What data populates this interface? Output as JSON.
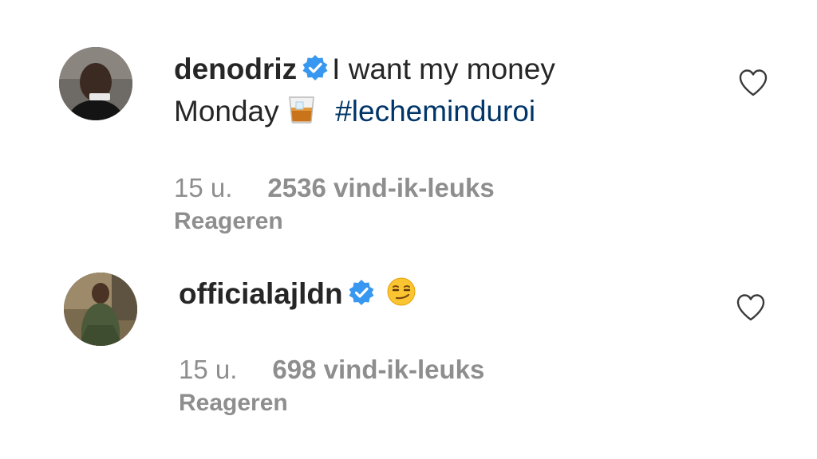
{
  "comments": [
    {
      "username": "denodriz",
      "text_line1": "I want my money",
      "text_line2": "Monday",
      "hashtag": "#lecheminduroi",
      "time": "15 u.",
      "likes": "2536 vind-ik-leuks",
      "reply_label": "Reageren",
      "emoji": "whisky-glass-emoji",
      "verified_icon": "verified-badge-icon",
      "heart_icon": "heart-outline-icon"
    },
    {
      "username": "officialajldn",
      "time": "15 u.",
      "likes": "698 vind-ik-leuks",
      "reply_label": "Reageren",
      "emoji": "smirking-face-emoji",
      "verified_icon": "verified-badge-icon",
      "heart_icon": "heart-outline-icon"
    }
  ],
  "colors": {
    "text": "#262626",
    "meta": "#8e8e8e",
    "hashtag": "#003569",
    "verified": "#3897f0"
  }
}
